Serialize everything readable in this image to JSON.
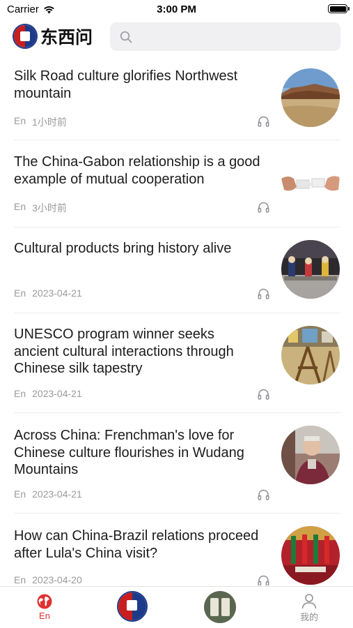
{
  "status_bar": {
    "carrier": "Carrier",
    "time": "3:00 PM"
  },
  "header": {
    "logo_text": "东西问",
    "search_icon": "search-icon"
  },
  "news": [
    {
      "title": "Silk Road culture glorifies Northwest mountain",
      "lang": "En",
      "time": "1小时前",
      "thumb": "desert-mountain"
    },
    {
      "title": "The China-Gabon relationship is a good example of mutual cooperation",
      "lang": "En",
      "time": "3小时前",
      "thumb": "puzzle-hands"
    },
    {
      "title": "Cultural products bring history alive",
      "lang": "En",
      "time": "2023-04-21",
      "thumb": "figurines"
    },
    {
      "title": "UNESCO program winner seeks ancient cultural interactions through Chinese silk tapestry",
      "lang": "En",
      "time": "2023-04-21",
      "thumb": "loom-workshop"
    },
    {
      "title": "Across China: Frenchman's love for Chinese culture flourishes in Wudang Mountains",
      "lang": "En",
      "time": "2023-04-21",
      "thumb": "elder-man"
    },
    {
      "title": "How can China-Brazil relations proceed after Lula's China visit?",
      "lang": "En",
      "time": "2023-04-20",
      "thumb": "flags-hall"
    }
  ],
  "tabs": [
    {
      "label": "En",
      "icon": "globe-icon",
      "active": true
    },
    {
      "label": "",
      "icon": "dongxiwen-logo-icon",
      "active": false
    },
    {
      "label": "",
      "icon": "hanxue-seal-icon",
      "active": false
    },
    {
      "label": "我的",
      "icon": "person-icon",
      "active": false
    }
  ],
  "colors": {
    "accent": "#e03131",
    "meta": "#9a9a9a",
    "search_bg": "#f0f0f2"
  }
}
